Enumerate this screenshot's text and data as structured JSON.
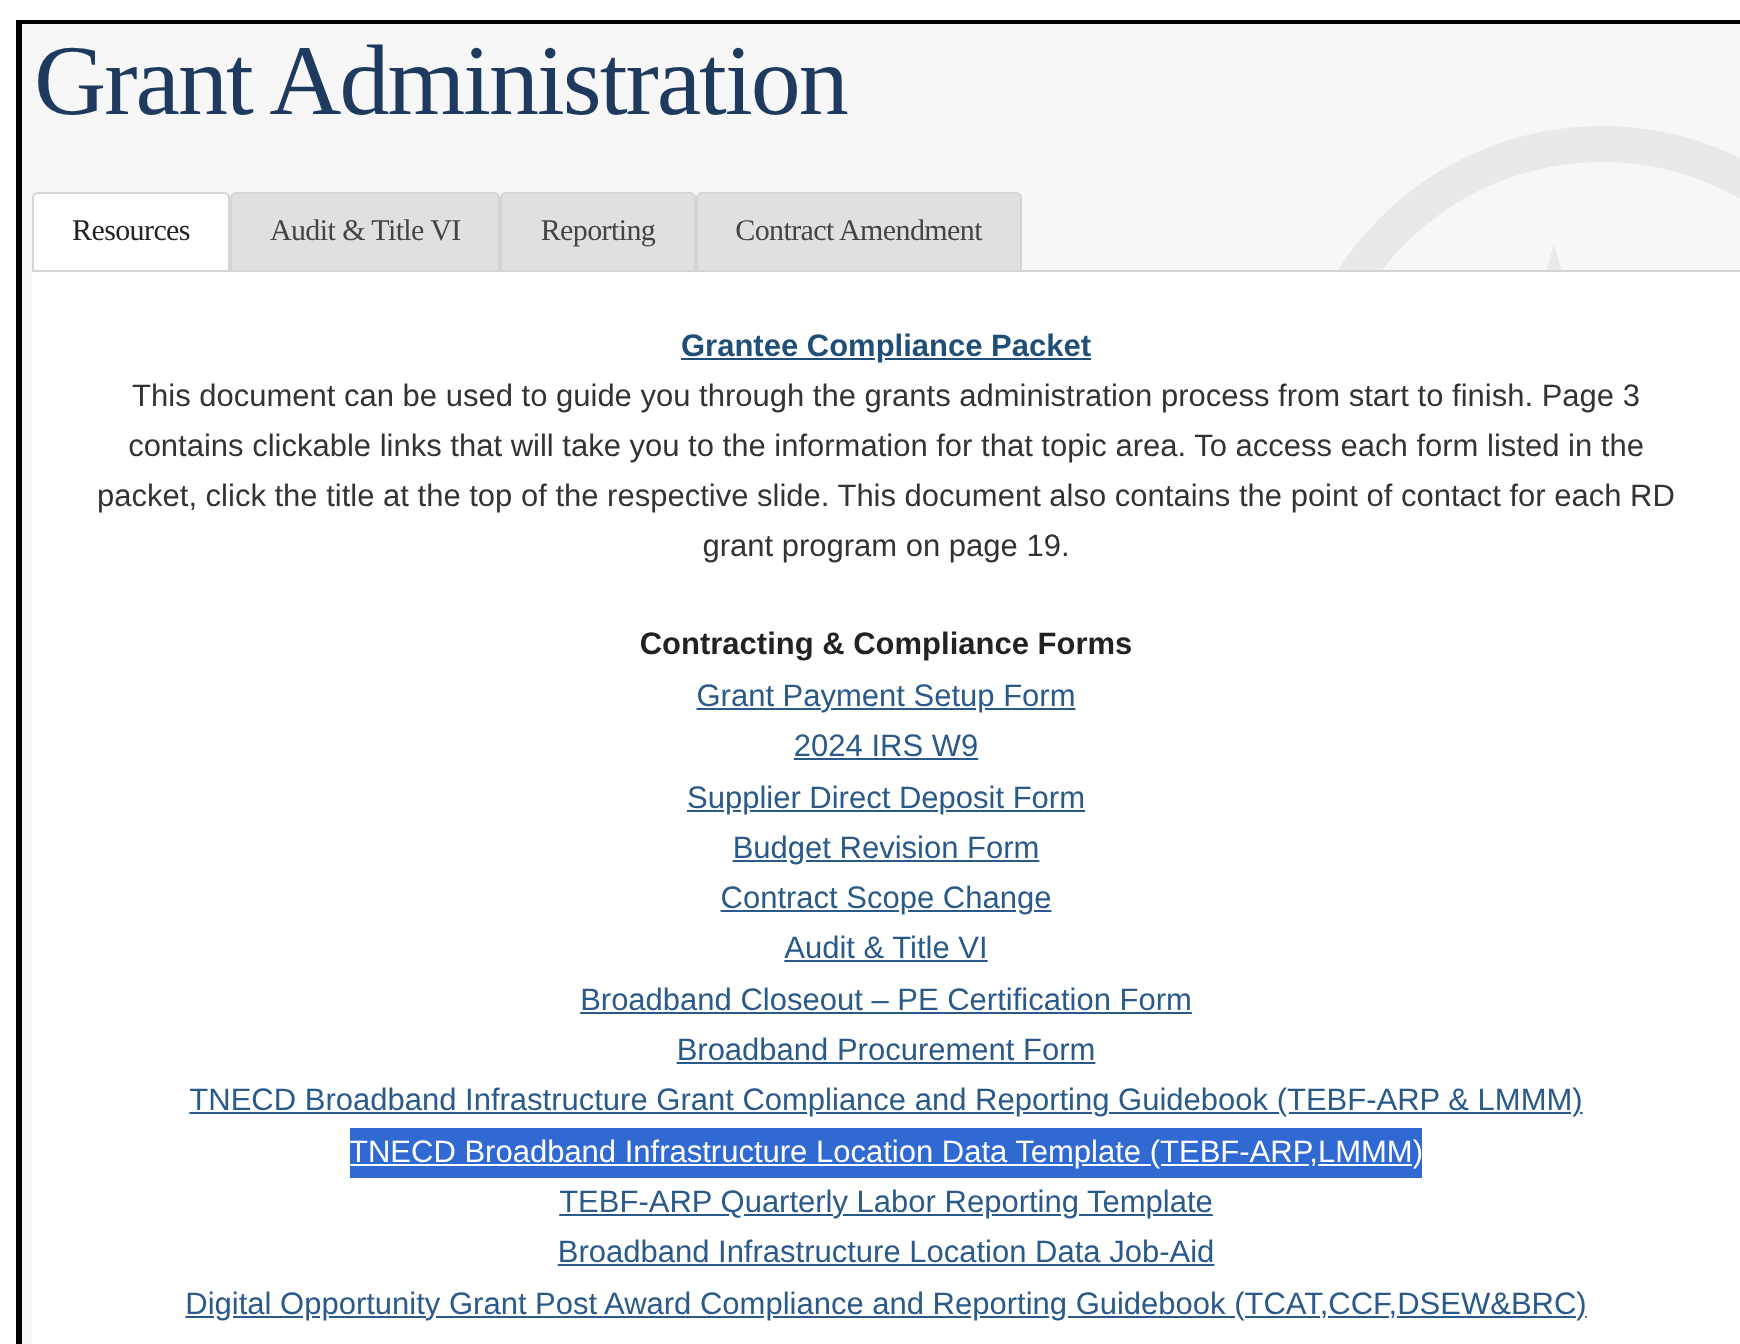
{
  "page": {
    "title": "Grant Administration"
  },
  "tabs": [
    {
      "label": "Resources",
      "selected": true
    },
    {
      "label": "Audit & Title VI",
      "selected": false
    },
    {
      "label": "Reporting",
      "selected": false
    },
    {
      "label": "Contract Amendment",
      "selected": false
    }
  ],
  "packet": {
    "link": "Grantee Compliance Packet",
    "description": "This document can be used to guide you through the grants administration process from start to finish. Page 3 contains clickable links that will take you to the information for that topic area. To access each form listed in the packet, click the title at the top of the respective slide. This document also contains the point of contact for each RD grant program on page 19."
  },
  "forms": {
    "heading": "Contracting & Compliance Forms",
    "links": [
      {
        "label": "Grant Payment Setup Form",
        "highlighted": false
      },
      {
        "label": "2024 IRS W9",
        "highlighted": false
      },
      {
        "label": "Supplier Direct Deposit Form",
        "highlighted": false
      },
      {
        "label": "Budget Revision Form",
        "highlighted": false
      },
      {
        "label": "Contract Scope Change",
        "highlighted": false
      },
      {
        "label": "Audit & Title VI",
        "highlighted": false
      },
      {
        "label": "Broadband Closeout – PE Certification Form",
        "highlighted": false
      },
      {
        "label": "Broadband Procurement Form",
        "highlighted": false
      },
      {
        "label": "TNECD Broadband Infrastructure Grant Compliance and Reporting Guidebook (TEBF-ARP & LMMM)",
        "highlighted": false
      },
      {
        "label": "TNECD Broadband Infrastructure Location Data Template (TEBF-ARP,LMMM)",
        "highlighted": true
      },
      {
        "label": "TEBF-ARP Quarterly Labor Reporting Template",
        "highlighted": false
      },
      {
        "label": "Broadband Infrastructure Location Data Job-Aid",
        "highlighted": false
      },
      {
        "label": "Digital Opportunity Grant Post Award Compliance and Reporting Guidebook (TCAT,CCF,DSEW&BRC)",
        "highlighted": false
      }
    ]
  }
}
